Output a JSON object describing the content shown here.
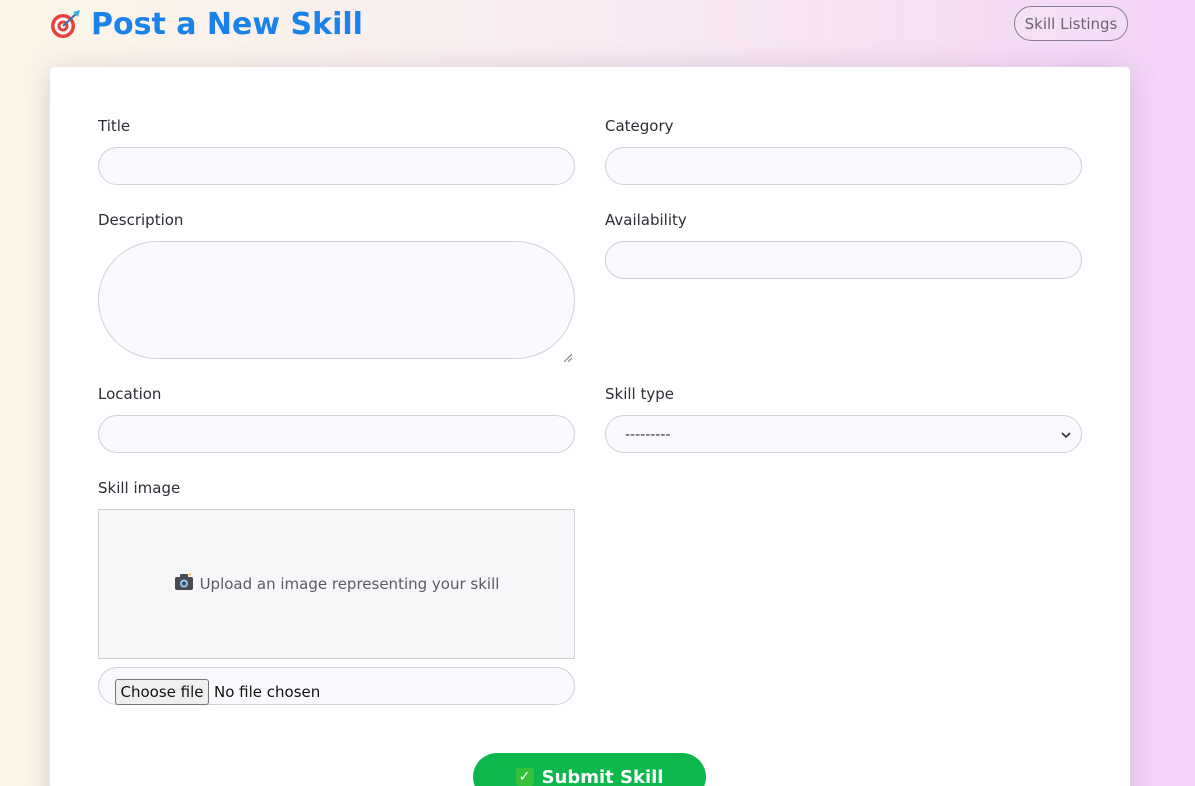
{
  "header": {
    "title": "Post a New Skill",
    "title_icon": "target-icon",
    "nav_button_label": "Skill Listings"
  },
  "form": {
    "title_label": "Title",
    "title_value": "",
    "category_label": "Category",
    "category_value": "",
    "description_label": "Description",
    "description_value": "",
    "availability_label": "Availability",
    "availability_value": "",
    "location_label": "Location",
    "location_value": "",
    "skill_type_label": "Skill type",
    "skill_type_selected": "---------",
    "skill_image_label": "Skill image",
    "upload_prompt": "Upload an image representing your skill",
    "upload_icon": "camera-icon",
    "choose_file_label": "Choose file",
    "file_status": "No file chosen",
    "submit_label": "Submit Skill",
    "submit_icon": "check-icon"
  },
  "colors": {
    "title": "#1a82e8",
    "submit_button": "#0cb74c",
    "card_background": "#ffffff"
  }
}
